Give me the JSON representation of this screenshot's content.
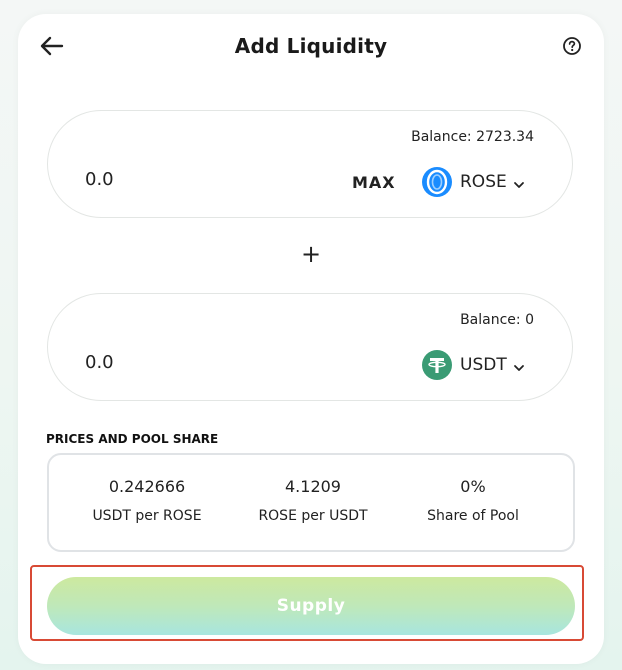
{
  "header": {
    "title": "Add Liquidity",
    "back_icon": "arrow-left-icon",
    "help_icon": "question-circle-icon"
  },
  "token_a": {
    "balance_label": "Balance: 2723.34",
    "amount_value": "0.0",
    "max_label": "MAX",
    "symbol": "ROSE",
    "icon": "rose-token-icon",
    "icon_color": "#1a8cff"
  },
  "plus_label": "+",
  "token_b": {
    "balance_label": "Balance: 0",
    "amount_value": "0.0",
    "symbol": "USDT",
    "icon": "usdt-token-icon",
    "icon_color": "#3a9b74"
  },
  "pool": {
    "section_label": "PRICES AND POOL SHARE",
    "items": [
      {
        "value": "0.242666",
        "label": "USDT per ROSE"
      },
      {
        "value": "4.1209",
        "label": "ROSE per USDT"
      },
      {
        "value": "0%",
        "label": "Share of Pool"
      }
    ]
  },
  "supply": {
    "label": "Supply",
    "highlight_color": "#d84a35"
  }
}
